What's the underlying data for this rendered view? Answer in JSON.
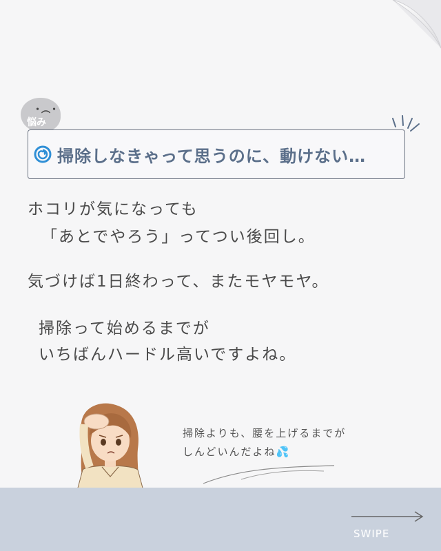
{
  "badge": {
    "face": "・︵・",
    "label": "悩み"
  },
  "headline": {
    "icon": "spiral-icon",
    "text": "掃除しなきゃって思うのに、動けない…"
  },
  "paragraphs": {
    "line1": "ホコリが気になっても",
    "line2": "「あとでやろう」ってつい後回し。",
    "line3": "気づけば1日終わって、またモヤモヤ。",
    "line4": "掃除って始めるまでが",
    "line5": "いちばんハードル高いですよね。"
  },
  "speech": {
    "line1": "掃除よりも、腰を上げるまでが",
    "line2": "しんどいんだよね💦"
  },
  "footer": {
    "swipe": "SWIPE",
    "arrow_icon": "arrow-right-icon"
  },
  "colors": {
    "headline_text": "#5b6f8a",
    "spiral": "#2f8fd6",
    "bottom_band": "#c9d1dd"
  }
}
